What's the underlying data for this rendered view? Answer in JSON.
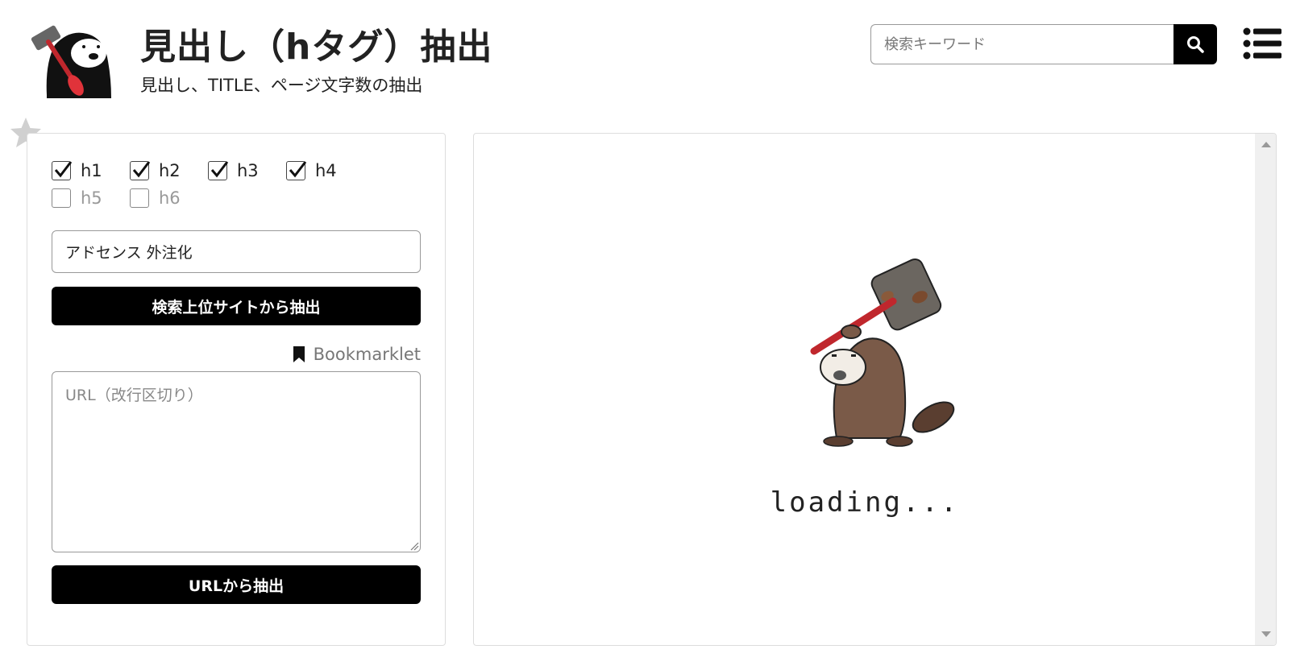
{
  "header": {
    "title": "見出し（hタグ）抽出",
    "subtitle": "見出し、TITLE、ページ文字数の抽出",
    "logo": "otter-hammer-logo",
    "search": {
      "placeholder": "検索キーワード",
      "button_icon": "search-icon"
    },
    "menu_icon": "list-menu-icon"
  },
  "favorite_icon": "star-icon",
  "left_panel": {
    "checkboxes": [
      {
        "label": "h1",
        "checked": true
      },
      {
        "label": "h2",
        "checked": true
      },
      {
        "label": "h3",
        "checked": true
      },
      {
        "label": "h4",
        "checked": true
      },
      {
        "label": "h5",
        "checked": false
      },
      {
        "label": "h6",
        "checked": false
      }
    ],
    "keyword_value": "アドセンス 外注化",
    "search_button_label": "検索上位サイトから抽出",
    "bookmarklet_label": "Bookmarklet",
    "bookmarklet_icon": "bookmark-icon",
    "url_placeholder": "URL（改行区切り）",
    "url_button_label": "URLから抽出"
  },
  "right_panel": {
    "loading_text": "loading...",
    "loader_image": "otter-with-hammer-illustration"
  },
  "colors": {
    "button_bg": "#000000",
    "button_text": "#ffffff",
    "border": "#999999",
    "panel_border": "#dddddd",
    "hammer_handle": "#c0272d"
  }
}
